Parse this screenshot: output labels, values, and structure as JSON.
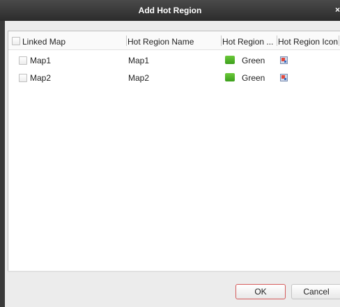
{
  "window": {
    "title": "Add Hot Region",
    "close_glyph": "×"
  },
  "table": {
    "headers": {
      "linked_map": "Linked Map",
      "hot_region_name": "Hot Region Name",
      "hot_region_color": "Hot Region ...",
      "hot_region_icon": "Hot Region Icon"
    },
    "rows": [
      {
        "linked_map": "Map1",
        "name": "Map1",
        "color_name": "Green",
        "color": "#4fb82a",
        "checked": false,
        "icon": "hot-region-picture-icon"
      },
      {
        "linked_map": "Map2",
        "name": "Map2",
        "color_name": "Green",
        "color": "#4fb82a",
        "checked": false,
        "icon": "hot-region-picture-icon"
      }
    ]
  },
  "buttons": {
    "ok": "OK",
    "cancel": "Cancel"
  },
  "colors": {
    "ok_border": "#d55b5b",
    "swatch_green": "#4fb82a",
    "titlebar": "#3a3a3a"
  }
}
